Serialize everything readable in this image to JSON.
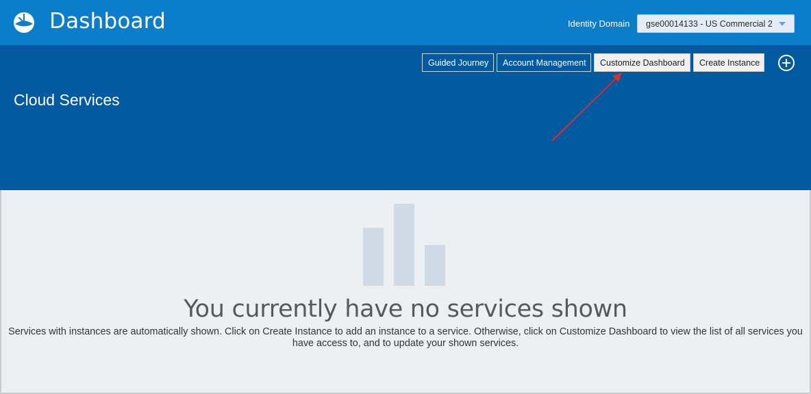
{
  "header": {
    "title": "Dashboard",
    "logo_icon": "oracle-cloud-logo-icon",
    "identity_domain_label": "Identity Domain",
    "identity_domain_value": "gse00014133 - US Commercial 2"
  },
  "hero": {
    "title": "Cloud Services",
    "buttons": {
      "guided_journey": "Guided Journey",
      "account_management": "Account Management",
      "customize_dashboard": "Customize Dashboard",
      "create_instance": "Create Instance"
    },
    "add_icon": "plus-circle-icon"
  },
  "empty_state": {
    "icon": "bar-chart-icon",
    "title": "You currently have no services shown",
    "description": "Services with instances are automatically shown. Click on Create Instance to add an instance to a service. Otherwise, click on Customize Dashboard to view the list of all services you have access to, and to update your shown services."
  },
  "annotation": {
    "type": "red-arrow",
    "target": "Customize Dashboard"
  },
  "colors": {
    "topbar": "#0a7ecb",
    "hero": "#045aa0",
    "page_bg": "#edf0f3",
    "annotation_arrow": "#d0312d",
    "empty_graphic": "#cfdae6"
  }
}
